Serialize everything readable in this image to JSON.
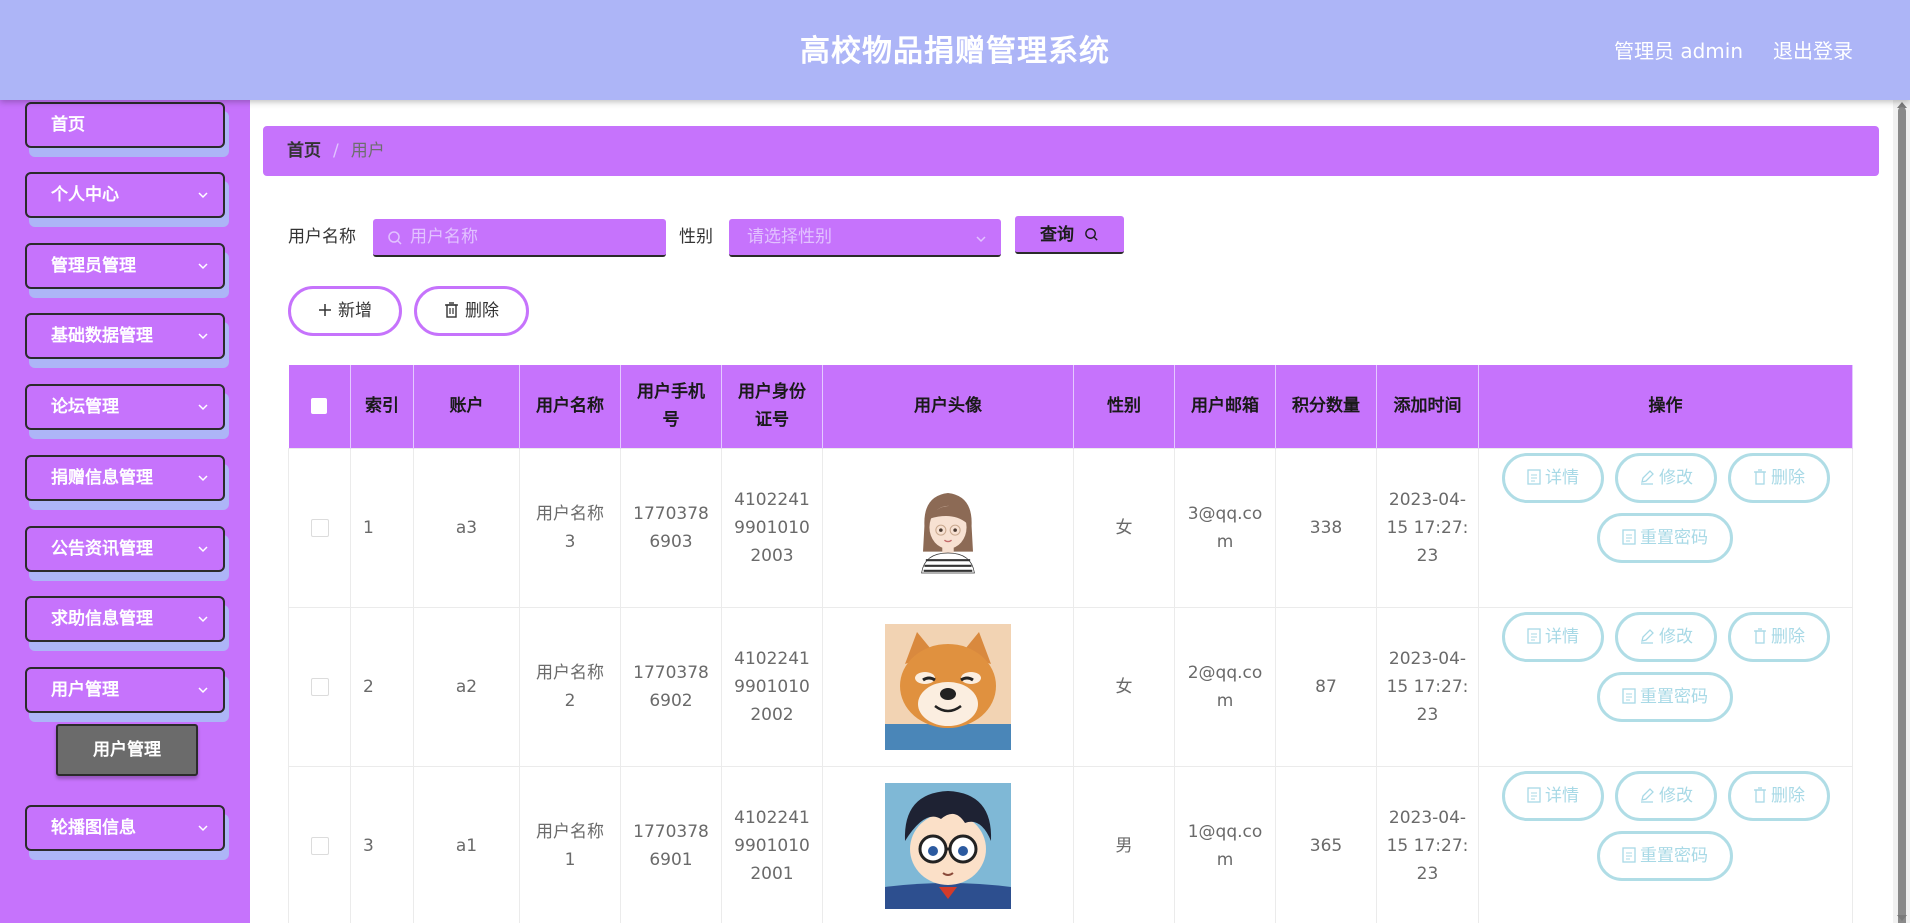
{
  "header": {
    "title": "高校物品捐赠管理系统",
    "admin": "管理员 admin",
    "logout": "退出登录"
  },
  "sidebar": {
    "items": [
      {
        "label": "首页",
        "has_chevron": false
      },
      {
        "label": "个人中心",
        "has_chevron": true
      },
      {
        "label": "管理员管理",
        "has_chevron": true
      },
      {
        "label": "基础数据管理",
        "has_chevron": true
      },
      {
        "label": "论坛管理",
        "has_chevron": true
      },
      {
        "label": "捐赠信息管理",
        "has_chevron": true
      },
      {
        "label": "公告资讯管理",
        "has_chevron": true
      },
      {
        "label": "求助信息管理",
        "has_chevron": true
      },
      {
        "label": "用户管理",
        "has_chevron": true
      },
      {
        "label": "轮播图信息",
        "has_chevron": true
      }
    ],
    "active_sub": "用户管理"
  },
  "breadcrumb": {
    "home": "首页",
    "sep": "/",
    "current": "用户"
  },
  "search": {
    "name_label": "用户名称",
    "name_placeholder": "用户名称",
    "gender_label": "性别",
    "gender_placeholder": "请选择性别",
    "query_label": "查询"
  },
  "actions": {
    "add": "新增",
    "delete": "删除"
  },
  "table": {
    "headers": [
      "索引",
      "账户",
      "用户名称",
      "用户手机号",
      "用户身份证号",
      "用户头像",
      "性别",
      "用户邮箱",
      "积分数量",
      "添加时间",
      "操作"
    ],
    "rows": [
      {
        "index": "1",
        "account": "a3",
        "name": "用户名称3",
        "phone": "17703786903",
        "id_card": "410224199010102003",
        "avatar": "girl-avatar",
        "gender": "女",
        "email": "3@qq.com",
        "points": "338",
        "time": "2023-04-15 17:27:23"
      },
      {
        "index": "2",
        "account": "a2",
        "name": "用户名称2",
        "phone": "17703786902",
        "id_card": "410224199010102002",
        "avatar": "shiba-dog-avatar",
        "gender": "女",
        "email": "2@qq.com",
        "points": "87",
        "time": "2023-04-15 17:27:23"
      },
      {
        "index": "3",
        "account": "a1",
        "name": "用户名称1",
        "phone": "17703786901",
        "id_card": "410224199010102001",
        "avatar": "cartoon-boy-avatar",
        "gender": "男",
        "email": "1@qq.com",
        "points": "365",
        "time": "2023-04-15 17:27:23"
      }
    ],
    "op_labels": {
      "detail": "详情",
      "edit": "修改",
      "delete": "删除",
      "reset": "重置密码"
    }
  },
  "colors": {
    "primary": "#c673fc",
    "header": "#adb5f7",
    "op_border": "#b0dde6"
  }
}
